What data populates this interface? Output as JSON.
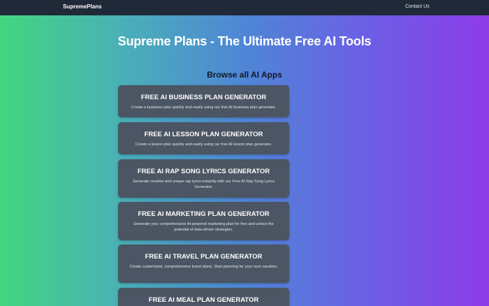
{
  "nav": {
    "brand": "SupremePlans",
    "contact_label": "Contact Us"
  },
  "hero": {
    "title": "Supreme Plans - The Ultimate Free AI Tools"
  },
  "apps_section": {
    "heading": "Browse all AI Apps",
    "cards": [
      {
        "title": "FREE AI BUSINESS PLAN GENERATOR",
        "description": "Create a business plan quickly and easily using our free AI business plan generator."
      },
      {
        "title": "FREE AI LESSON PLAN GENERATOR",
        "description": "Create a lesson plan quickly and easily using our free AI lesson plan generator."
      },
      {
        "title": "FREE AI RAP SONG LYRICS GENERATOR",
        "description": "Generate creative and unique rap lyrics instantly with our Free AI Rap Song Lyrics Generator."
      },
      {
        "title": "FREE AI MARKETING PLAN GENERATOR",
        "description": "Generate your comprehensive AI-powered marketing plan for free and unlock the potential of data-driven strategies."
      },
      {
        "title": "FREE AI TRAVEL PLAN GENERATOR",
        "description": "Create customized, comprehensive travel plans. Start planning for your next vacation."
      },
      {
        "title": "FREE AI MEAL PLAN GENERATOR",
        "description": ""
      }
    ]
  },
  "colors": {
    "topbar": "#1f2937",
    "card": "#4b5563",
    "gradient_start": "#43d67f",
    "gradient_end": "#8e3be8"
  }
}
